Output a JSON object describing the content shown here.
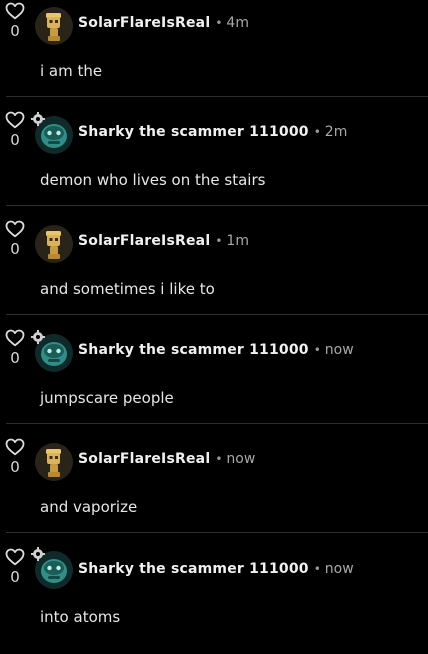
{
  "comments": [
    {
      "likes": "0",
      "username": "SolarFlareIsReal",
      "separator": "•",
      "time": "4m",
      "text": "i am the",
      "avatar": "golden-robot-avatar",
      "badge": ""
    },
    {
      "likes": "0",
      "username": "Sharky the scammer 111000",
      "separator": "•",
      "time": "2m",
      "text": "demon who lives on the stairs",
      "avatar": "teal-robot-avatar",
      "badge": "gear-badge-icon"
    },
    {
      "likes": "0",
      "username": "SolarFlareIsReal",
      "separator": "•",
      "time": "1m",
      "text": "and sometimes i like to",
      "avatar": "golden-robot-avatar",
      "badge": ""
    },
    {
      "likes": "0",
      "username": "Sharky the scammer 111000",
      "separator": "•",
      "time": "now",
      "text": "jumpscare people",
      "avatar": "teal-robot-avatar",
      "badge": "gear-badge-icon"
    },
    {
      "likes": "0",
      "username": "SolarFlareIsReal",
      "separator": "•",
      "time": "now",
      "text": "and vaporize",
      "avatar": "golden-robot-avatar",
      "badge": ""
    },
    {
      "likes": "0",
      "username": "Sharky the scammer 111000",
      "separator": "•",
      "time": "now",
      "text": "into atoms",
      "avatar": "teal-robot-avatar",
      "badge": "gear-badge-icon"
    }
  ],
  "colors": {
    "background": "#000000",
    "divider": "#2e2e2e",
    "text": "#e6e6e6",
    "muted": "#a8a8a8",
    "gold_avatar": "#d9b45a",
    "teal_avatar": "#2f8f88"
  }
}
